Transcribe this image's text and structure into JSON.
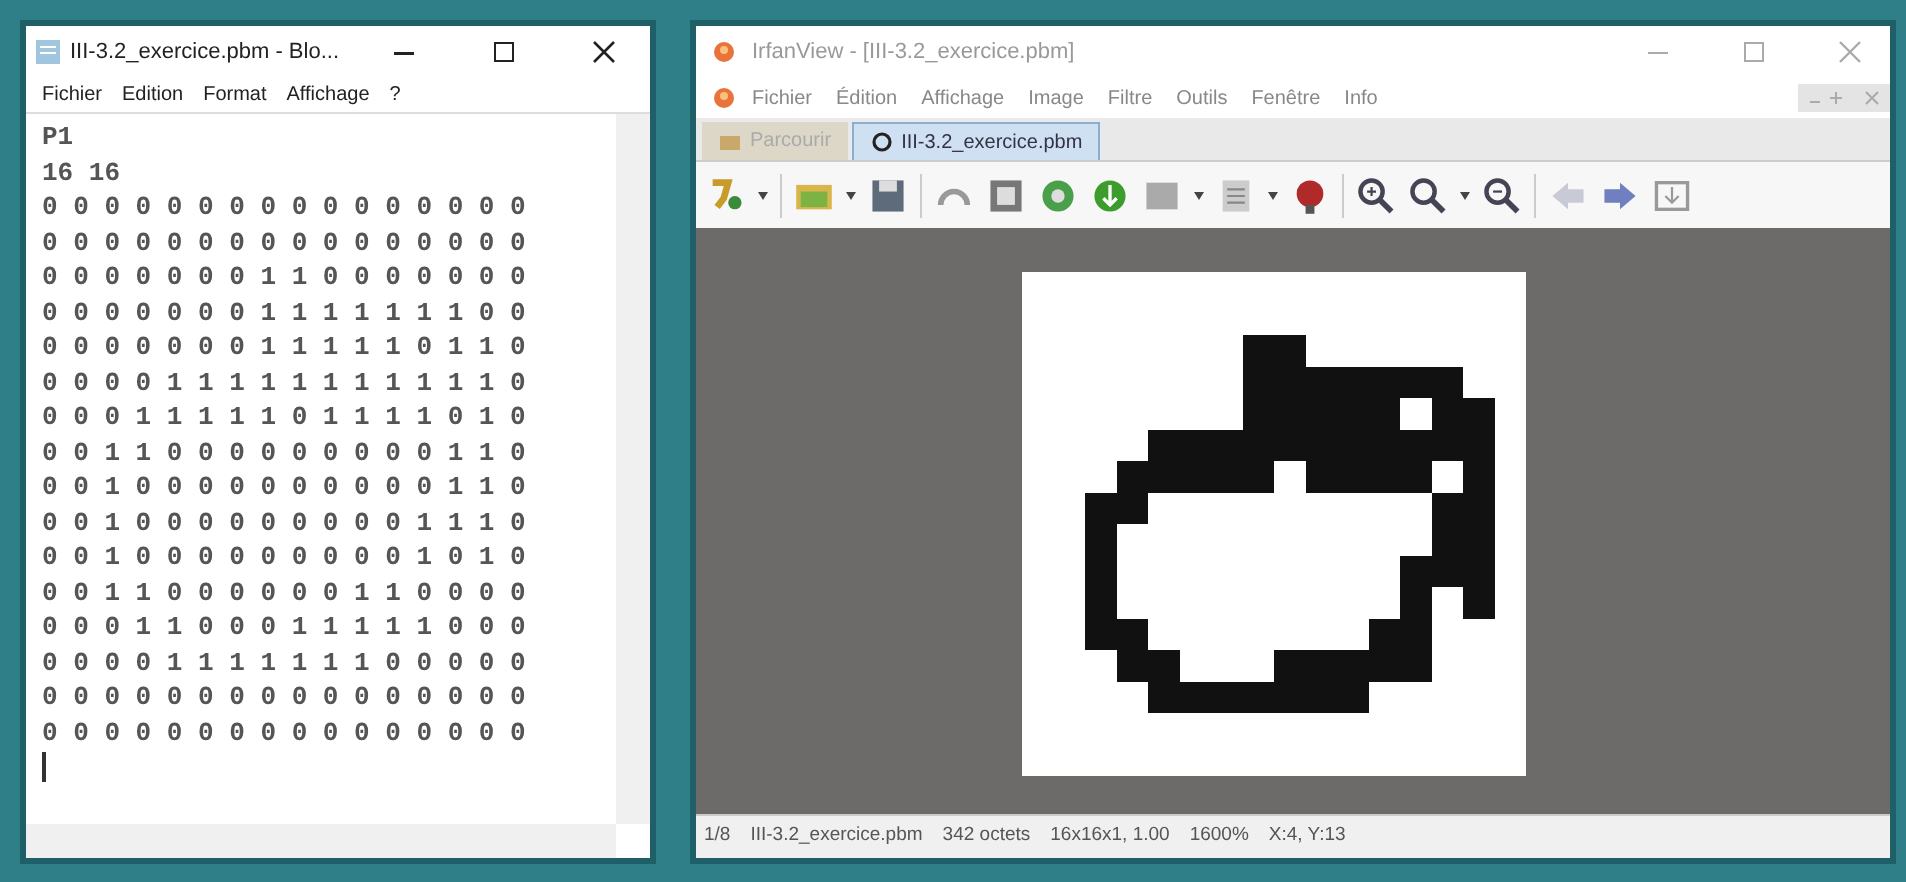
{
  "notepad": {
    "title": "III-3.2_exercice.pbm - Blo...",
    "menu": [
      "Fichier",
      "Edition",
      "Format",
      "Affichage",
      "?"
    ],
    "lines": [
      "P1",
      "16 16",
      "0 0 0 0 0 0 0 0 0 0 0 0 0 0 0 0",
      "0 0 0 0 0 0 0 0 0 0 0 0 0 0 0 0",
      "0 0 0 0 0 0 0 1 1 0 0 0 0 0 0 0",
      "0 0 0 0 0 0 0 1 1 1 1 1 1 1 0 0",
      "0 0 0 0 0 0 0 1 1 1 1 1 0 1 1 0",
      "0 0 0 0 1 1 1 1 1 1 1 1 1 1 1 0",
      "0 0 0 1 1 1 1 1 0 1 1 1 1 0 1 0",
      "0 0 1 1 0 0 0 0 0 0 0 0 0 1 1 0",
      "0 0 1 0 0 0 0 0 0 0 0 0 0 1 1 0",
      "0 0 1 0 0 0 0 0 0 0 0 0 1 1 1 0",
      "0 0 1 0 0 0 0 0 0 0 0 0 1 0 1 0",
      "0 0 1 1 0 0 0 0 0 0 1 1 0 0 0 0",
      "0 0 0 1 1 0 0 0 1 1 1 1 1 0 0 0",
      "0 0 0 0 1 1 1 1 1 1 1 0 0 0 0 0",
      "0 0 0 0 0 0 0 0 0 0 0 0 0 0 0 0",
      "0 0 0 0 0 0 0 0 0 0 0 0 0 0 0 0"
    ]
  },
  "viewer": {
    "title": "IrfanView - [III-3.2_exercice.pbm]",
    "menu": [
      "Fichier",
      "Édition",
      "Affichage",
      "Image",
      "Filtre",
      "Outils",
      "Fenêtre",
      "Info"
    ],
    "tabs": [
      {
        "label": "Parcourir",
        "selected": false
      },
      {
        "label": "III-3.2_exercice.pbm",
        "selected": true
      }
    ],
    "status": [
      "1/8",
      "III-3.2_exercice.pbm",
      "342 octets",
      "16x16x1, 1.00",
      "1600%",
      "X:4, Y:13"
    ]
  }
}
